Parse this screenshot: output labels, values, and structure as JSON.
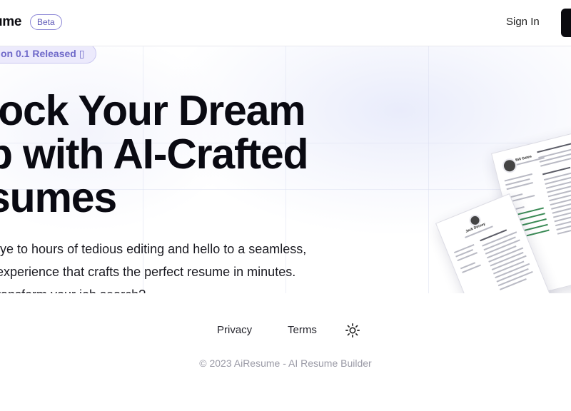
{
  "header": {
    "brand": "ume",
    "beta_label": "Beta",
    "sign_in": "Sign In"
  },
  "hero": {
    "release_badge": "on 0.1 Released ▯",
    "headline": "lock Your Dream\nb with AI-Crafted\nsumes",
    "subtext": "bye to hours of tedious editing and hello to a seamless,\n experience that crafts the perfect resume in minutes.\ntransform your job search?"
  },
  "resume_previews": {
    "front_name": "Jack Dorsey",
    "back_name": "Bill Gates"
  },
  "footer": {
    "links": [
      "Privacy",
      "Terms"
    ],
    "theme_icon": "sun-icon",
    "copyright": "© 2023 AiResume - AI Resume Builder"
  }
}
